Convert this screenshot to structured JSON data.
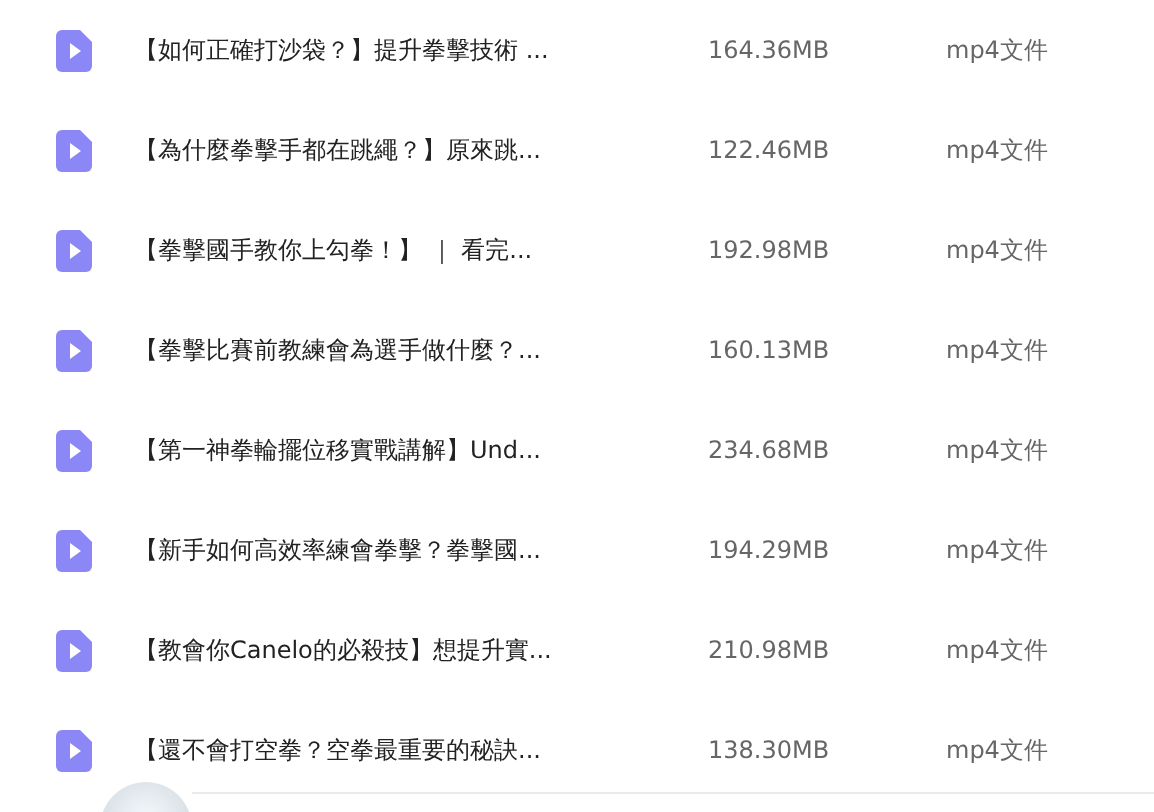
{
  "files": [
    {
      "name": "【如何正確打沙袋？】提升拳擊技術 ...",
      "size": "164.36MB",
      "type": "mp4文件"
    },
    {
      "name": "【為什麼拳擊手都在跳繩？】原來跳...",
      "size": "122.46MB",
      "type": "mp4文件"
    },
    {
      "name": "【拳擊國手教你上勾拳！】 ｜ 看完...",
      "size": "192.98MB",
      "type": "mp4文件"
    },
    {
      "name": "【拳擊比賽前教練會為選手做什麼？...",
      "size": "160.13MB",
      "type": "mp4文件"
    },
    {
      "name": "【第一神拳輪擺位移實戰講解】Und...",
      "size": "234.68MB",
      "type": "mp4文件"
    },
    {
      "name": "【新手如何高效率練會拳擊？拳擊國...",
      "size": "194.29MB",
      "type": "mp4文件"
    },
    {
      "name": "【教會你Canelo的必殺技】想提升實...",
      "size": "210.98MB",
      "type": "mp4文件"
    },
    {
      "name": "【還不會打空拳？空拳最重要的秘訣...",
      "size": "138.30MB",
      "type": "mp4文件"
    }
  ]
}
